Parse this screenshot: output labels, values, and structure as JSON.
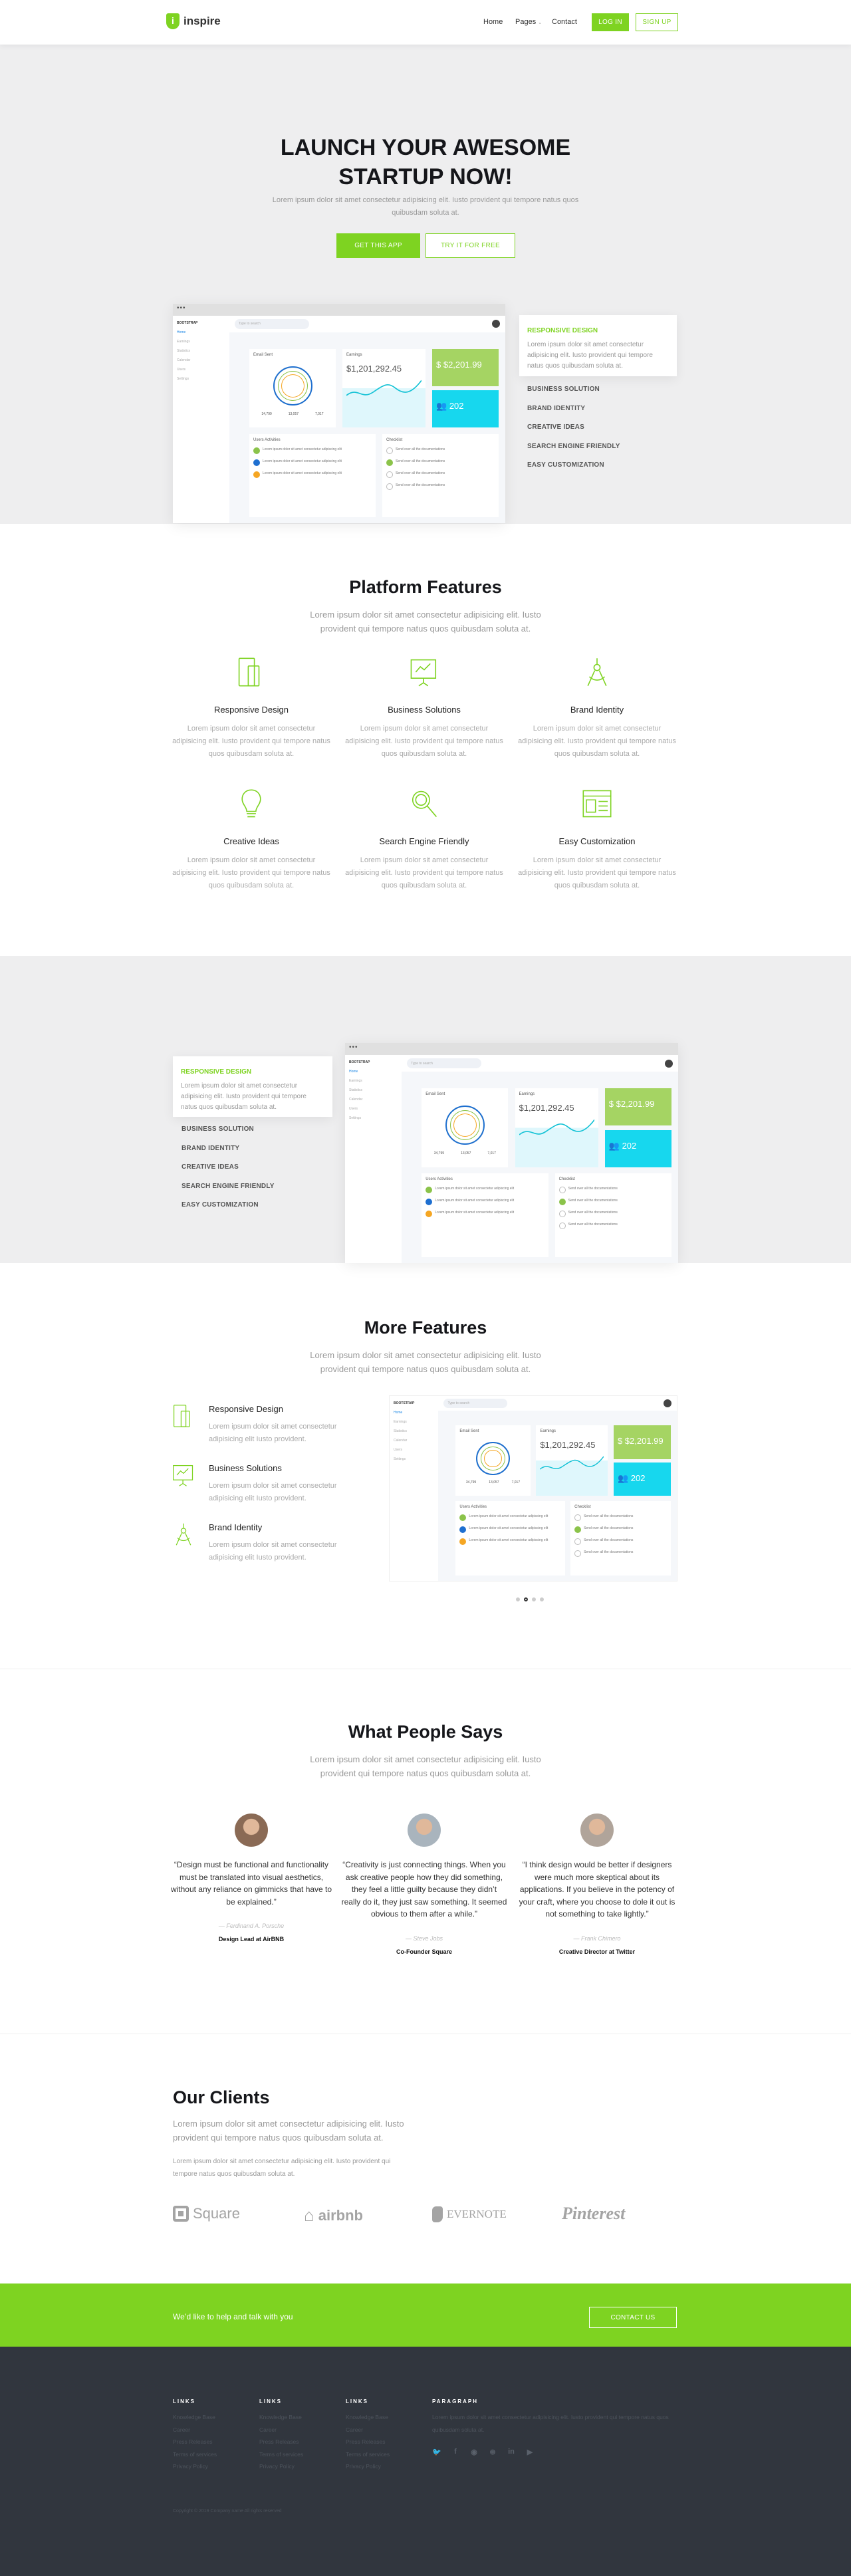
{
  "colors": {
    "accent": "#7ed321",
    "footer": "#31363e",
    "hero_bg": "#eeeeef"
  },
  "nav": {
    "logo_letter": "i",
    "logo": "inspire",
    "links": [
      "Home",
      "Pages",
      "Contact"
    ],
    "login": "LOG IN",
    "signup": "SIGN UP"
  },
  "hero": {
    "title1": "LAUNCH YOUR AWESOME",
    "title2": "STARTUP NOW!",
    "desc": "Lorem ipsum dolor sit amet consectetur adipisicing elit. Iusto provident qui tempore natus quos quibusdam soluta at.",
    "cta1": "GET THIS APP",
    "cta2": "TRY IT FOR FREE"
  },
  "mock": {
    "brand": "BOOTSTRAP",
    "search": "Type to search",
    "menu": [
      "Home",
      "Earnings",
      "Statistics",
      "Calendar",
      "Users",
      "Settings"
    ],
    "email_title": "Email Sent",
    "earn_title": "Earnings",
    "earn_value": "$1,201,292.45",
    "money": "$2,201.99",
    "users": "202",
    "legend": [
      "34,799",
      "13,057",
      "7,017"
    ],
    "act_title": "Users Activities",
    "check_title": "Checklist",
    "act_item": "Lorem ipsum dolor sit amet consectetur adipiscing elit",
    "check_item": "Send over all the documentations"
  },
  "showcase": {
    "card_title": "RESPONSIVE DESIGN",
    "card_text": "Lorem ipsum dolor sit amet consectetur adipisicing elit. Iusto provident qui tempore natus quos quibusdam soluta at.",
    "items": [
      "BUSINESS SOLUTION",
      "BRAND IDENTITY",
      "CREATIVE IDEAS",
      "SEARCH ENGINE FRIENDLY",
      "EASY CUSTOMIZATION"
    ]
  },
  "platform": {
    "title": "Platform Features",
    "desc": "Lorem ipsum dolor sit amet consectetur adipisicing elit. Iusto provident qui tempore natus quos quibusdam soluta at.",
    "features": [
      {
        "title": "Responsive Design",
        "icon": "devices-icon",
        "text": "Lorem ipsum dolor sit amet consectetur adipisicing elit. Iusto provident qui tempore natus quos quibusdam soluta at."
      },
      {
        "title": "Business Solutions",
        "icon": "presentation-chart-icon",
        "text": "Lorem ipsum dolor sit amet consectetur adipisicing elit. Iusto provident qui tempore natus quos quibusdam soluta at."
      },
      {
        "title": "Brand Identity",
        "icon": "compass-tool-icon",
        "text": "Lorem ipsum dolor sit amet consectetur adipisicing elit. Iusto provident qui tempore natus quos quibusdam soluta at."
      },
      {
        "title": "Creative Ideas",
        "icon": "lightbulb-icon",
        "text": "Lorem ipsum dolor sit amet consectetur adipisicing elit. Iusto provident qui tempore natus quos quibusdam soluta at."
      },
      {
        "title": "Search Engine Friendly",
        "icon": "magnifier-icon",
        "text": "Lorem ipsum dolor sit amet consectetur adipisicing elit. Iusto provident qui tempore natus quos quibusdam soluta at."
      },
      {
        "title": "Easy Customization",
        "icon": "browser-window-icon",
        "text": "Lorem ipsum dolor sit amet consectetur adipisicing elit. Iusto provident qui tempore natus quos quibusdam soluta at."
      }
    ]
  },
  "more": {
    "title": "More Features",
    "desc": "Lorem ipsum dolor sit amet consectetur adipisicing elit. Iusto provident qui tempore natus quos quibusdam soluta at.",
    "items": [
      {
        "title": "Responsive Design",
        "text": "Lorem ipsum dolor sit amet consectetur adipisicing elit Iusto provident."
      },
      {
        "title": "Business Solutions",
        "text": "Lorem ipsum dolor sit amet consectetur adipisicing elit Iusto provident."
      },
      {
        "title": "Brand Identity",
        "text": "Lorem ipsum dolor sit amet consectetur adipisicing elit Iusto provident."
      }
    ],
    "active_slide": 2,
    "slides": 4
  },
  "testimonials": {
    "title": "What People Says",
    "desc": "Lorem ipsum dolor sit amet consectetur adipisicing elit. Iusto provident qui tempore natus quos quibusdam soluta at.",
    "items": [
      {
        "quote": "“Design must be functional and functionality must be translated into visual aesthetics, without any reliance on gimmicks that have to be explained.”",
        "author": "— Ferdinand A. Porsche",
        "role": "Design Lead at AirBNB"
      },
      {
        "quote": "“Creativity is just connecting things. When you ask creative people how they did something, they feel a little guilty because they didn’t really do it, they just saw something. It seemed obvious to them after a while.”",
        "author": "— Steve Jobs",
        "role": "Co-Founder Square"
      },
      {
        "quote": "“I think design would be better if designers were much more skeptical about its applications. If you believe in the potency of your craft, where you choose to dole it out is not something to take lightly.”",
        "author": "— Frank Chimero",
        "role": "Creative Director at Twitter"
      }
    ]
  },
  "clients": {
    "title": "Our Clients",
    "desc": "Lorem ipsum dolor sit amet consectetur adipisicing elit. Iusto provident qui tempore natus quos quibusdam soluta at.",
    "desc2": "Lorem ipsum dolor sit amet consectetur adipisicing elit. Iusto provident qui tempore natus quos quibusdam soluta at.",
    "logos": [
      "Square",
      "airbnb",
      "EVERNOTE",
      "Pinterest"
    ]
  },
  "cta": {
    "text": "We’d like to help and talk with you",
    "button": "CONTACT US"
  },
  "footer": {
    "cols": [
      {
        "title": "LINKS",
        "links": [
          "Knowledge Base",
          "Career",
          "Press Releases",
          "Terms of services",
          "Privacy Policy"
        ]
      },
      {
        "title": "LINKS",
        "links": [
          "Knowledge Base",
          "Career",
          "Press Releases",
          "Terms of services",
          "Privacy Policy"
        ]
      },
      {
        "title": "LINKS",
        "links": [
          "Knowledge Base",
          "Career",
          "Press Releases",
          "Terms of services",
          "Privacy Policy"
        ]
      }
    ],
    "para_title": "PARAGRAPH",
    "para": "Lorem ipsum dolor sit amet consectetur adipisicing elit. Iusto provident qui tempore natus quos quibusdam soluta at.",
    "social": [
      "twitter-icon",
      "facebook-icon",
      "github-icon",
      "dribbble-icon",
      "linkedin-icon",
      "youtube-icon"
    ],
    "copyright": "Copyright © 2019 Company name All rights reserved"
  }
}
